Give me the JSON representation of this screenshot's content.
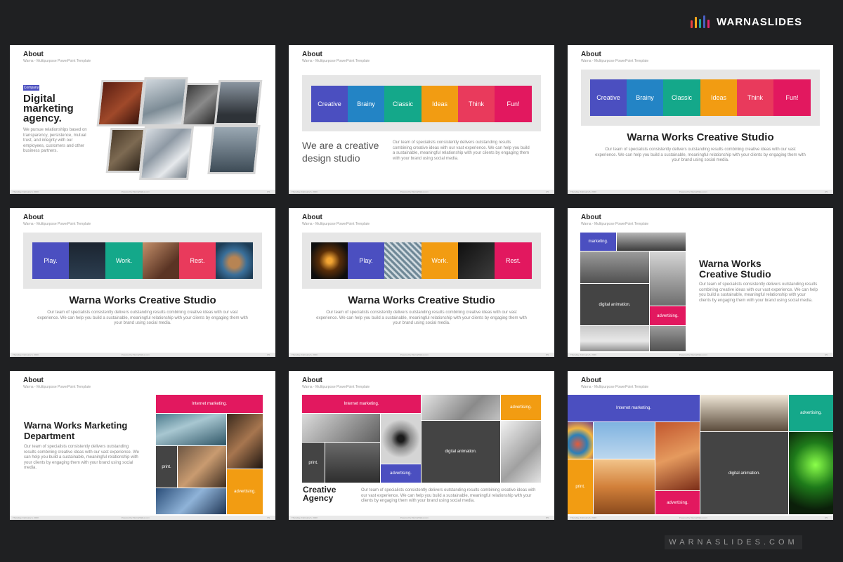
{
  "brand": {
    "name": "WARNASLIDES",
    "bar_colors": [
      "#e8403f",
      "#f7a71b",
      "#1ea79b",
      "#4a5fc1",
      "#e0266d"
    ]
  },
  "footer_url": "WARNASLIDES.COM",
  "colors": {
    "purple": "#4b4fc0",
    "blue": "#2384c5",
    "teal": "#14a88a",
    "orange": "#f29c12",
    "pinkred": "#e93a5c",
    "magenta": "#e2185f",
    "dark": "#444444",
    "bg": "#1f2022"
  },
  "common": {
    "title": "About",
    "subtitle": "Warna - Multipurpose PowerPoint Template",
    "foot_left": "Thursday, February 6, 2020",
    "foot_center": "Powered by WarnaSlides.com"
  },
  "slide1": {
    "badge": "Company",
    "heading": "Digital marketing agency.",
    "text": "We pursue relationships based on transparency, persistence, mutual trust, and integrity with our employees, customers and other business partners.",
    "page": "1/9"
  },
  "slide2": {
    "tiles": [
      "Creative",
      "Brainy",
      "Classic",
      "Ideas",
      "Think",
      "Fun!"
    ],
    "heading": "We are a creative design studio",
    "text": "Our team of specialists consistently delivers outstanding results combining creative ideas with our vast experience. We can help you build a sustainable, meaningful relationship with your clients by engaging them with your brand using social media.",
    "page": "2/9"
  },
  "slide3": {
    "tiles": [
      "Creative",
      "Brainy",
      "Classic",
      "Ideas",
      "Think",
      "Fun!"
    ],
    "heading": "Warna Works Creative Studio",
    "text": "Our team of specialists consistently delivers outstanding results combining creative ideas with our vast experience. We can help you build a sustainable, meaningful relationship with your clients by engaging them with your brand using social media.",
    "page": "3/9"
  },
  "slide4": {
    "tiles": [
      "Play.",
      "Work.",
      "Rest."
    ],
    "heading": "Warna Works Creative Studio",
    "text": "Our team of specialists consistently delivers outstanding results combining creative ideas with our vast experience. We can help you build a sustainable, meaningful relationship with your clients by engaging them with your brand using social media.",
    "page": "4/9"
  },
  "slide5": {
    "tiles": [
      "Play.",
      "Work.",
      "Rest."
    ],
    "heading": "Warna Works Creative Studio",
    "text": "Our team of specialists consistently delivers outstanding results combining creative ideas with our vast experience. We can help you build a sustainable, meaningful relationship with your clients by engaging them with your brand using social media.",
    "page": "5/9"
  },
  "slide6": {
    "tiles": [
      "marketing.",
      "digital animation.",
      "advertising."
    ],
    "heading": "Warna Works Creative Studio",
    "text": "Our team of specialists consistently delivers outstanding results combining creative ideas with our vast experience. We can help you build a sustainable, meaningful relationship with your clients by engaging them with your brand using social media.",
    "page": "6/9"
  },
  "slide7": {
    "tiles": [
      "Internet marketing.",
      "print.",
      "advertising."
    ],
    "heading": "Warna Works Marketing Department",
    "text": "Our team of specialists consistently delivers outstanding results combining creative ideas with our vast experience. We can help you build a sustainable, meaningful relationship with your clients by engaging them with your brand using social media.",
    "page": "7/9"
  },
  "slide8": {
    "tiles": [
      "Internet marketing.",
      "advertising.",
      "digital animation.",
      "print.",
      "advertising."
    ],
    "heading": "Creative Agency",
    "text": "Our team of specialists consistently delivers outstanding results combining creative ideas with our vast experience. We can help you build a sustainable, meaningful relationship with your clients by engaging them with your brand using social media.",
    "page": "8/9"
  },
  "slide9": {
    "tiles": [
      "Internet marketing.",
      "advertising.",
      "digital animation.",
      "print.",
      "advertising."
    ],
    "page": "9/9"
  }
}
